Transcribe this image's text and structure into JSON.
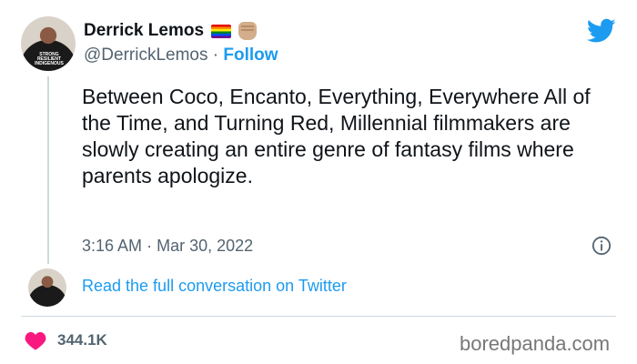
{
  "author": {
    "name": "Derrick Lemos",
    "handle": "@DerrickLemos",
    "separator": "·",
    "follow_label": "Follow",
    "avatar_shirt_text": "STRONG RESILIENT INDIGENOUS"
  },
  "tweet": {
    "text": "Between Coco, Encanto, Everything, Everywhere All of the Time, and Turning Red, Millennial filmmakers are slowly creating an entire genre of fantasy films where parents apologize.",
    "time": "3:16 AM",
    "date": "Mar 30, 2022",
    "time_separator": "·"
  },
  "conversation": {
    "link_label": "Read the full conversation on Twitter"
  },
  "stats": {
    "likes": "344.1K"
  },
  "watermark": "boredpanda.com",
  "colors": {
    "twitter_blue": "#1d9bf0",
    "heart_pink": "#f91880",
    "text_primary": "#0f1419",
    "text_secondary": "#536471"
  },
  "icons": {
    "brand": "twitter-bird-icon",
    "info": "info-icon",
    "like": "heart-icon",
    "flag": "rainbow-flag-icon",
    "emoji": "raised-fist-icon"
  }
}
